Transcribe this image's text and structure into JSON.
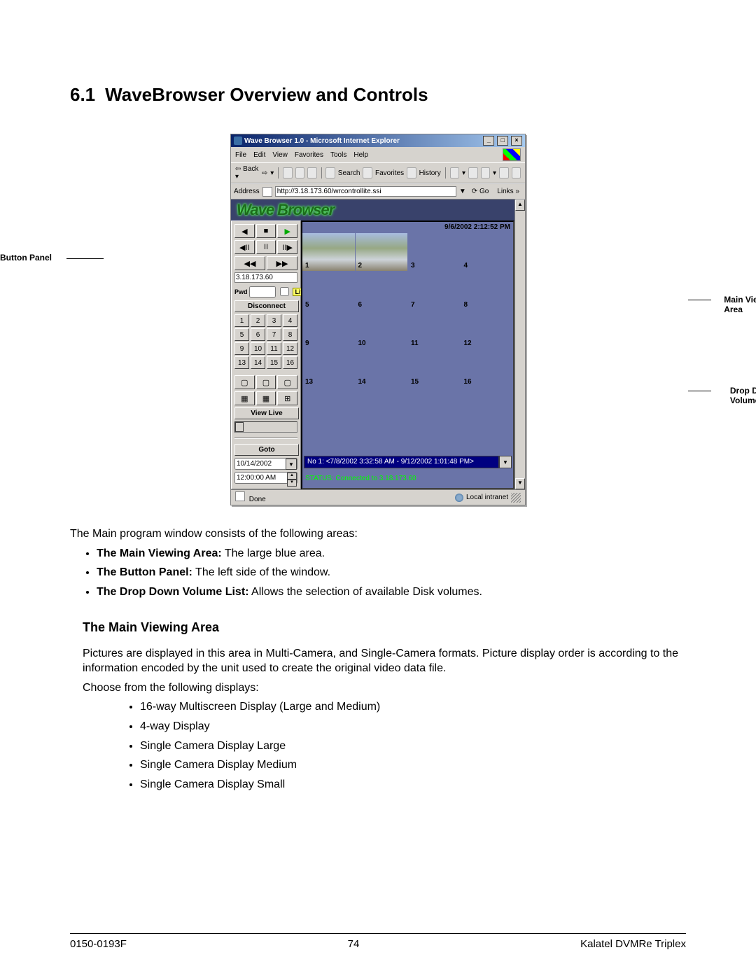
{
  "section": {
    "number": "6.1",
    "title": "WaveBrowser Overview and Controls"
  },
  "callouts": {
    "button_panel": "Button Panel",
    "viewing_area_l1": "Main Viewing",
    "viewing_area_l2": "Area",
    "dropdown_l1": "Drop Down",
    "dropdown_l2": "Volume List"
  },
  "ie": {
    "title": "Wave Browser 1.0 - Microsoft Internet Explorer",
    "window_buttons": {
      "min": "_",
      "max": "□",
      "close": "×"
    },
    "menus": {
      "file": "File",
      "edit": "Edit",
      "view": "View",
      "favorites": "Favorites",
      "tools": "Tools",
      "help": "Help"
    },
    "toolbar": {
      "back": "Back",
      "search": "Search",
      "favorites": "Favorites",
      "history": "History"
    },
    "address_label": "Address",
    "address_value": "http://3.18.173.60/wrcontrollite.ssi",
    "go": "Go",
    "links": "Links",
    "status_left": "Done",
    "status_right": "Local intranet"
  },
  "wave": {
    "logo": "Wave Browser",
    "timestamp": "9/6/2002 2:12:52 PM",
    "ip": "3.18.173.60",
    "pwd_label": "Pwd",
    "live_label": "Live",
    "connect_btn": "Disconnect",
    "camera_numbers": [
      "1",
      "2",
      "3",
      "4",
      "5",
      "6",
      "7",
      "8",
      "9",
      "10",
      "11",
      "12",
      "13",
      "14",
      "15",
      "16"
    ],
    "view_live": "View Live",
    "goto": "Goto",
    "date": "10/14/2002",
    "time": "12:00:00 AM",
    "grid_numbers": [
      "1",
      "2",
      "3",
      "4",
      "5",
      "6",
      "7",
      "8",
      "9",
      "10",
      "11",
      "12",
      "13",
      "14",
      "15",
      "16"
    ],
    "volume_selected": "No 1: <7/8/2002 3:32:58 AM - 9/12/2002 1:01:48 PM>",
    "status": "STATUS: Connected to 3.18.173.60"
  },
  "text": {
    "intro": "The Main program window consists of the following areas:",
    "b1_bold": "The Main Viewing Area:",
    "b1_rest": " The large blue area.",
    "b2_bold": "The Button Panel:",
    "b2_rest": " The left side of the window.",
    "b3_bold": "The Drop Down Volume List:",
    "b3_rest": " Allows the selection of available Disk volumes.",
    "sub1": "The Main Viewing Area",
    "para1": "Pictures are displayed in this area in Multi-Camera, and Single-Camera formats.  Picture display order is according to the information encoded by the unit used to create the original video data file.",
    "para2": "Choose from the following displays:",
    "d1": "16-way Multiscreen Display (Large and Medium)",
    "d2": "4-way Display",
    "d3": "Single Camera Display Large",
    "d4": "Single Camera Display Medium",
    "d5": "Single Camera Display Small"
  },
  "footer": {
    "left": "0150-0193F",
    "center": "74",
    "right": "Kalatel DVMRe Triplex"
  }
}
